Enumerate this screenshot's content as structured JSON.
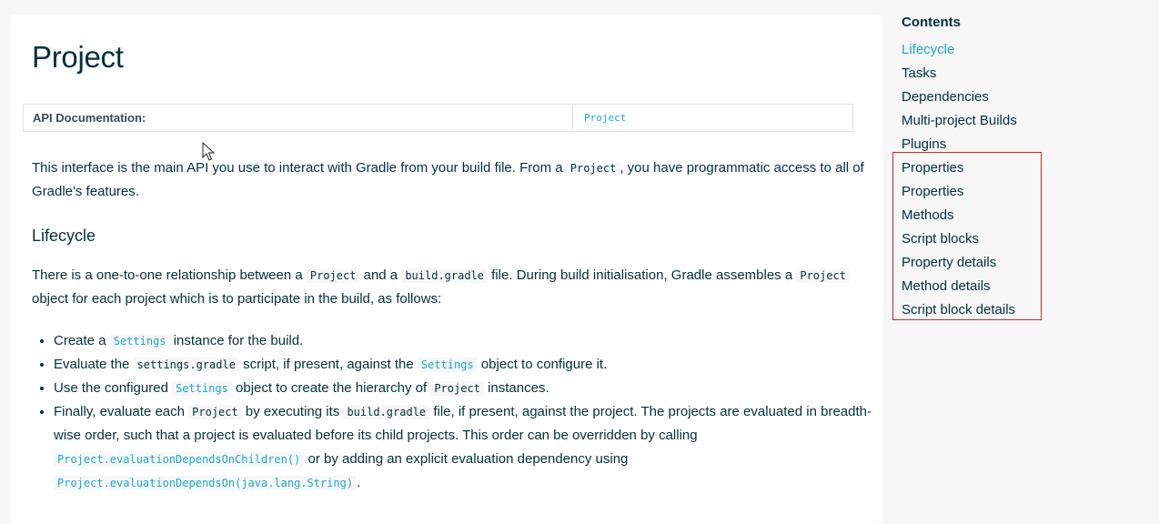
{
  "page": {
    "title": "Project",
    "api_label": "API Documentation:",
    "api_link": "Project"
  },
  "intro": {
    "t1": "This interface is the main API you use to interact with Gradle from your build file. From a ",
    "code1": "Project",
    "t2": ", you have programmatic access to all of Gradle's features."
  },
  "lifecycle": {
    "heading": "Lifecycle",
    "p": {
      "t1": "There is a one-to-one relationship between a ",
      "code1": "Project",
      "t2": " and a ",
      "code2": "build.gradle",
      "t3": " file. During build initialisation, Gradle assembles a ",
      "code3": "Project",
      "t4": " object for each project which is to participate in the build, as follows:"
    },
    "items": [
      {
        "t1": "Create a ",
        "code1": "Settings",
        "t2": " instance for the build."
      },
      {
        "t1": "Evaluate the ",
        "code1": "settings.gradle",
        "t2": " script, if present, against the ",
        "code2": "Settings",
        "t3": " object to configure it."
      },
      {
        "t1": "Use the configured ",
        "code1": "Settings",
        "t2": " object to create the hierarchy of ",
        "code2": "Project",
        "t3": " instances."
      },
      {
        "t1": "Finally, evaluate each ",
        "code1": "Project",
        "t2": " by executing its ",
        "code2": "build.gradle",
        "t3": " file, if present, against the project. The projects are evaluated in breadth-wise order, such that a project is evaluated before its child projects. This order can be overridden by calling ",
        "code3": "Project.evaluationDependsOnChildren()",
        "t4": " or by adding an explicit evaluation dependency using ",
        "code4": "Project.evaluationDependsOn(java.lang.String)",
        "t5": "."
      }
    ]
  },
  "toc": {
    "title": "Contents",
    "items": [
      "Lifecycle",
      "Tasks",
      "Dependencies",
      "Multi-project Builds",
      "Plugins",
      "Properties",
      "Properties",
      "Methods",
      "Script blocks",
      "Property details",
      "Method details",
      "Script block details"
    ],
    "active": "Lifecycle"
  },
  "colors": {
    "link": "#1ba8cb",
    "text": "#02303a",
    "highlight": "#e02020"
  }
}
